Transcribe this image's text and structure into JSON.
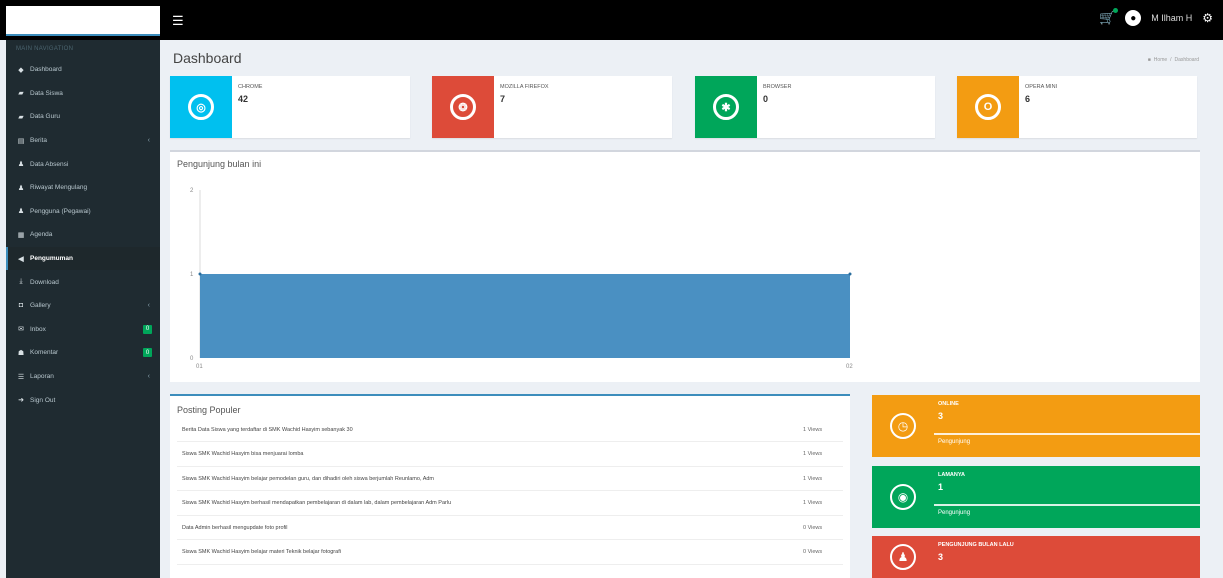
{
  "topbar": {
    "menu_icon": "hamburger-icon",
    "user_name": "M Ilham H"
  },
  "sidebar": {
    "header": "MAIN NAVIGATION",
    "items": [
      {
        "label": "Dashboard",
        "icon": "home-icon",
        "glyph": "◆"
      },
      {
        "label": "Data Siswa",
        "icon": "graduation-cap-icon",
        "glyph": "▰"
      },
      {
        "label": "Data Guru",
        "icon": "graduation-cap-icon",
        "glyph": "▰"
      },
      {
        "label": "Berita",
        "icon": "newspaper-icon",
        "glyph": "▤",
        "arrow": "‹"
      },
      {
        "label": "Data Absensi",
        "icon": "users-icon",
        "glyph": "♟"
      },
      {
        "label": "Riwayat Mengulang",
        "icon": "users-icon",
        "glyph": "♟"
      },
      {
        "label": "Pengguna (Pegawai)",
        "icon": "users-icon",
        "glyph": "♟"
      },
      {
        "label": "Agenda",
        "icon": "calendar-icon",
        "glyph": "▦"
      },
      {
        "label": "Pengumuman",
        "icon": "bullhorn-icon",
        "glyph": "◀",
        "active": true
      },
      {
        "label": "Download",
        "icon": "download-icon",
        "glyph": "⤓"
      },
      {
        "label": "Gallery",
        "icon": "camera-icon",
        "glyph": "◘",
        "arrow": "‹"
      },
      {
        "label": "Inbox",
        "icon": "envelope-icon",
        "glyph": "✉",
        "badge": "0"
      },
      {
        "label": "Komentar",
        "icon": "comments-icon",
        "glyph": "☗",
        "badge": "0"
      },
      {
        "label": "Laporan",
        "icon": "list-icon",
        "glyph": "☰",
        "arrow": "‹"
      },
      {
        "label": "Sign Out",
        "icon": "sign-out-icon",
        "glyph": "➜"
      }
    ]
  },
  "page": {
    "title": "Dashboard",
    "breadcrumb": [
      "Home",
      "/",
      "Dashboard"
    ]
  },
  "info_boxes": [
    {
      "label": "CHROME",
      "value": "42",
      "color": "#00c0ef",
      "icon": "chrome-icon",
      "glyph": "◎"
    },
    {
      "label": "MOZILLA FIREFOX",
      "value": "7",
      "color": "#dd4b39",
      "icon": "firefox-icon",
      "glyph": "❂"
    },
    {
      "label": "BROWSER",
      "value": "0",
      "color": "#00a65a",
      "icon": "bug-icon",
      "glyph": "✱"
    },
    {
      "label": "OPERA MINI",
      "value": "6",
      "color": "#f39c12",
      "icon": "opera-icon",
      "glyph": "O"
    }
  ],
  "chart_box": {
    "title": "Pengunjung bulan ini"
  },
  "chart_data": {
    "type": "area",
    "x": [
      "01",
      "02"
    ],
    "series": [
      {
        "values": [
          1,
          1
        ]
      }
    ],
    "y_ticks": [
      "2",
      "1",
      "0"
    ],
    "ylim": [
      0,
      2
    ],
    "color": "#4a90c2",
    "grid": false
  },
  "posting": {
    "title": "Posting Populer",
    "rows": [
      {
        "title": "Berita Data Siswa yang terdaftar di SMK Wachid Hasyim sebanyak 30",
        "views": "1 Views"
      },
      {
        "title": "Siswa SMK Wachid Hasyim bisa menjuarai lomba",
        "views": "1 Views"
      },
      {
        "title": "Siswa SMK Wachid Hasyim belajar pemodelan guru, dan dihadiri oleh siswa berjumlah Reunlamo, Adm",
        "views": "1 Views"
      },
      {
        "title": "Siswa SMK Wachid Hasyim berhasil mendapatkan pembelajaran di dalam lab, dalam pembelajaran Adm Parlu",
        "views": "1 Views"
      },
      {
        "title": "Data Admin berhasil mengupdate foto profil",
        "views": "0 Views"
      },
      {
        "title": "Siswa SMK Wachid Hasyim belajar materi Teknik belajar fotografi",
        "views": "0 Views"
      }
    ]
  },
  "stats": [
    {
      "label": "ONLINE",
      "value": "3",
      "desc": "Pengunjung",
      "color": "#f39c12",
      "icon": "clock-icon",
      "glyph": "◷"
    },
    {
      "label": "LAMANYA",
      "value": "1",
      "desc": "Pengunjung",
      "color": "#00a65a",
      "icon": "globe-icon",
      "glyph": "◉"
    },
    {
      "label": "PENGUNJUNG BULAN LALU",
      "value": "3",
      "desc": "",
      "color": "#dd4b39",
      "icon": "users-icon",
      "glyph": "♟"
    }
  ]
}
